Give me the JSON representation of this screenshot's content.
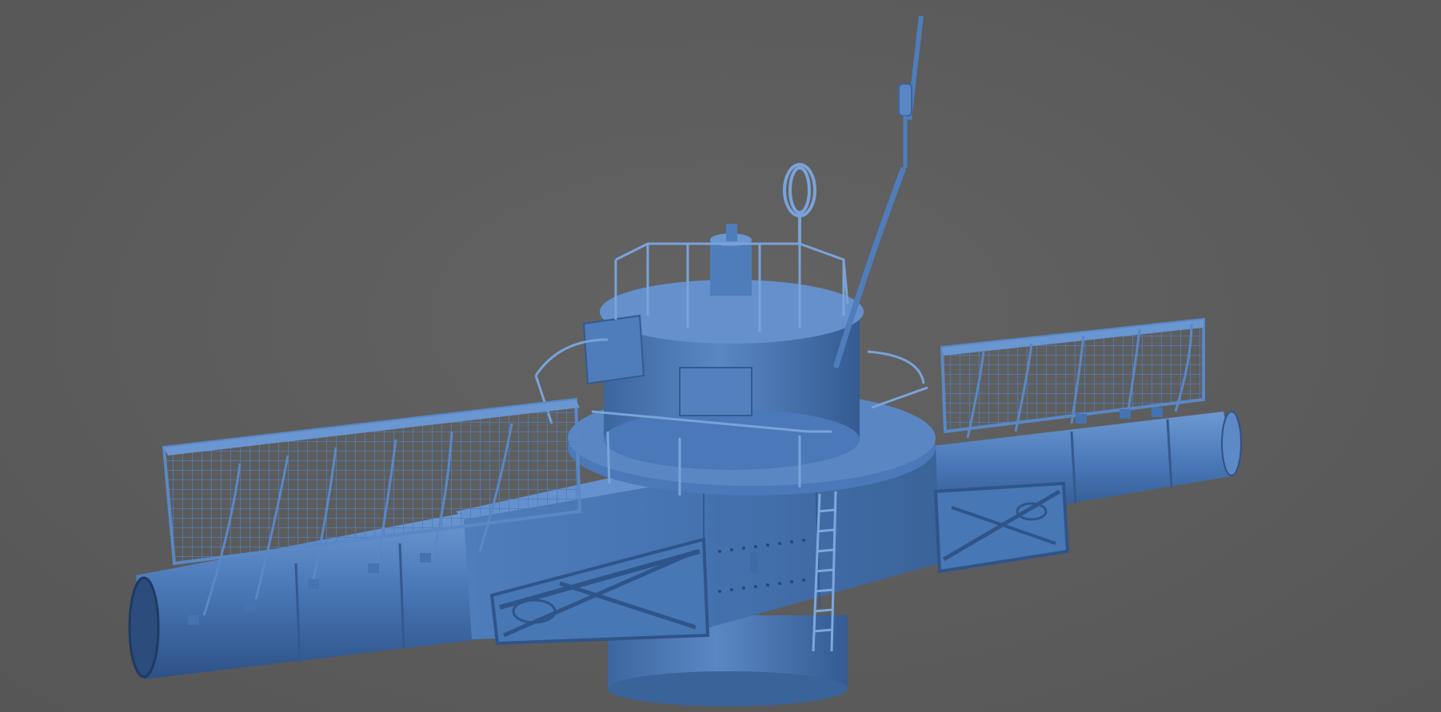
{
  "viewport": {
    "background_color": "#5b5b5b",
    "model_color": "#4a78b8",
    "model_dark_color": "#2c4f80",
    "model_light_color": "#6f9ad4"
  },
  "model": {
    "subject": "structure-with-tower-and-side-frames",
    "parts": [
      "antenna-mast",
      "loop-antenna",
      "central-tower",
      "tower-railing",
      "left-grid-frame",
      "right-grid-frame",
      "main-boom",
      "central-hub",
      "access-ladder",
      "truss-panel-left",
      "truss-panel-right"
    ]
  }
}
